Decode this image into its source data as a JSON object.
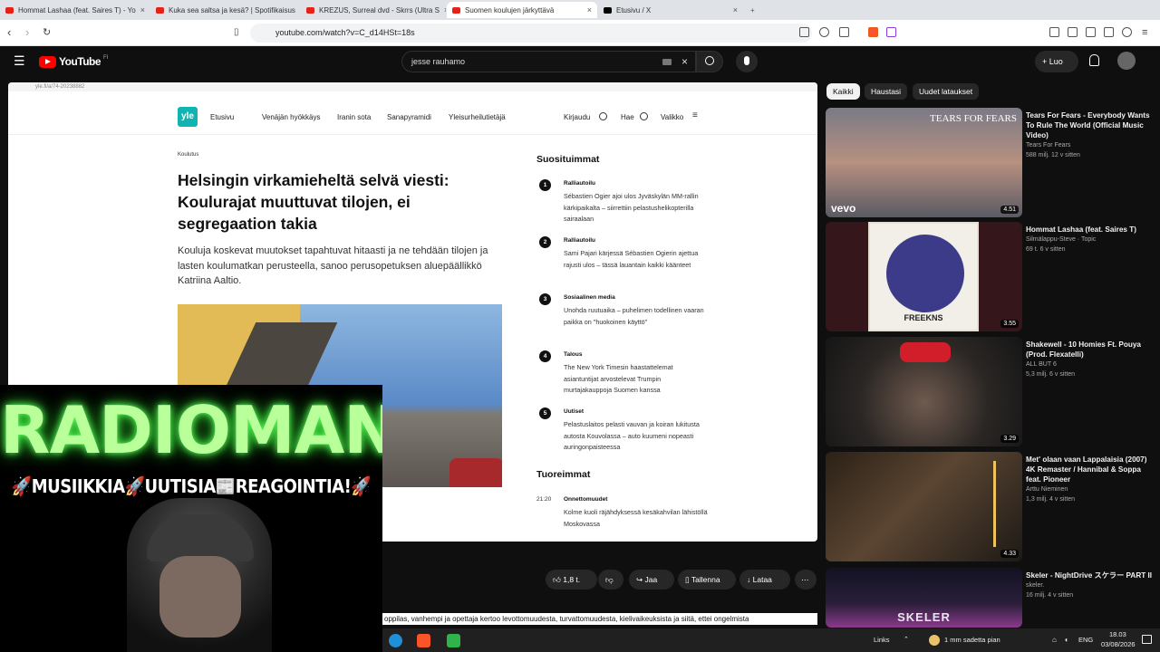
{
  "browser": {
    "tabs": [
      {
        "title": "Hommat Lashaa (feat. Saires T) - Yo"
      },
      {
        "title": "Kuka sea saltsa ja kesä? | Spotifikaisus"
      },
      {
        "title": "KREZUS, Surreal dvd - Skrrs (Ultra S"
      },
      {
        "title": "Suomen koulujen järkyttävä"
      },
      {
        "title": "Etusivu / X"
      }
    ],
    "url": "youtube.com/watch?v=C_d14HSt=18s"
  },
  "youtube": {
    "logo": "YouTube",
    "logo_region": "FI",
    "search_value": "jesse rauhamo",
    "create_label": "Luo",
    "chips": [
      "Kaikki",
      "Haustasi",
      "Uudet lataukset"
    ],
    "actions": {
      "like_count": "1,8 t.",
      "share": "Jaa",
      "save": "Tallenna",
      "download": "Lataa"
    }
  },
  "yle": {
    "url_text": "yle.fi/a/74-20238882",
    "logo": "yle",
    "nav": [
      "Etusivu",
      "Venäjän hyökkäys",
      "Iranin sota",
      "Sanapyramidi",
      "Yleisurheilutietäjä"
    ],
    "nav_right": {
      "login": "Kirjaudu",
      "search": "Hae",
      "menu": "Valikko"
    },
    "article": {
      "tag": "Koulutus",
      "headline": "Helsingin virkamieheltä selvä viesti: Koulurajat muuttuvat tilojen, ei segregaation takia",
      "lead": "Kouluja koskevat muutokset tapahtuvat hitaasti ja ne tehdään tilojen ja lasten koulumatkan perusteella, sanoo perusopetuksen aluepäällikkö Katriina Aaltio."
    },
    "popular_heading": "Suosituimmat",
    "popular": [
      {
        "num": "1",
        "category": "Ralliautoilu",
        "text": "Sébastien Ogier ajoi ulos Jyväskylän MM-rallin kärkipaikalta – siirrettiin pelastushelikopterilla sairaalaan"
      },
      {
        "num": "2",
        "category": "Ralliautoilu",
        "text": "Sami Pajari kärjessä Sébastien Ogierin ajettua rajusti ulos – tässä lauantain kaikki käänteet"
      },
      {
        "num": "3",
        "category": "Sosiaalinen media",
        "text": "Unohda ruutuaika – puhelimen todellinen vaaran paikka on \"huokoinen käyttö\""
      },
      {
        "num": "4",
        "category": "Talous",
        "text": "The New York Timesin haastattelemat asiantuntijat arvostelevat Trumpin murtajakauppoja Suomen kanssa"
      },
      {
        "num": "5",
        "category": "Uutiset",
        "text": "Pelastuslaitos pelasti vauvan ja koiran lukitusta autosta Kouvolassa – auto kuumeni nopeasti auringonpaisteessa"
      }
    ],
    "latest_heading": "Tuoreimmat",
    "latest": {
      "time": "21:20",
      "category": "Onnettomuudet",
      "text": "Kolme kuoli räjähdyksessä kesäkahvilan lähistöllä Moskovassa"
    }
  },
  "overlay": {
    "brand": "RADIOMANE",
    "tagline": "🚀MUSIIKKIA🚀UUTISIA📰REAGOINTIA!🚀"
  },
  "ticker": "oppilas, vanhempi ja opettaja kertoo levottomuudesta, turvattomuudesta, kielivaikeuksista ja siitä, ettei ongelmista",
  "recommendations": [
    {
      "title": "Tears For Fears - Everybody Wants To Rule The World (Official Music Video)",
      "channel": "Tears For Fears",
      "stats": "588 milj. 12 v sitten",
      "duration": "4.51",
      "thumb_text": "TEARS FOR FEARS",
      "thumb_brand": "vevo"
    },
    {
      "title": "Hommat Lashaa (feat. Saires T)",
      "channel": "Silmälappu-Steve · Topic",
      "stats": "69 t. 6 v sitten",
      "duration": "3.55",
      "thumb_text": "FREEKNS"
    },
    {
      "title": "Shakewell - 10 Homies Ft. Pouya (Prod. Flexatelli)",
      "channel": "ALL BUT 6",
      "stats": "5,3 milj. 6 v sitten",
      "duration": "3.29"
    },
    {
      "title": "Met' olaan vaan Lappalaisia (2007) 4K Remaster / Hannibal & Soppa feat. Pioneer",
      "channel": "Arttu Nieminen",
      "stats": "1,3 milj. 4 v sitten",
      "duration": "4.33"
    },
    {
      "title": "Skeler - NightDrive スケラー PART II",
      "channel": "skeler.",
      "stats": "16 milj. 4 v sitten",
      "duration": "",
      "thumb_text": "SKELER"
    }
  ],
  "taskbar": {
    "links": "Links",
    "weather": "1 mm sadetta pian",
    "lang": "ENG",
    "time": "18.03",
    "date": "03/08/2026"
  }
}
